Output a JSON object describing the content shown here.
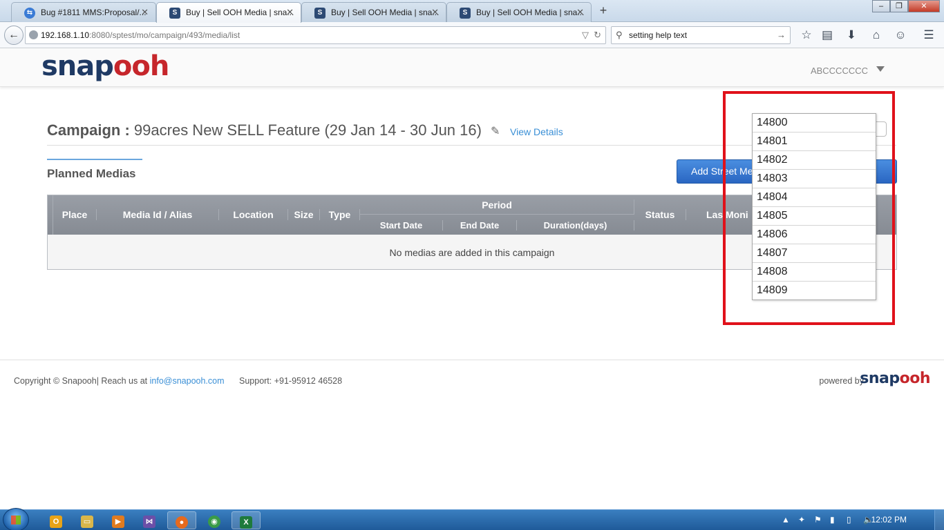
{
  "browser": {
    "tabs": [
      {
        "title": "Bug #1811 MMS:Proposal/...",
        "icon": "bug-tracker-favicon"
      },
      {
        "title": "Buy | Sell OOH Media | sna...",
        "icon": "snapooh-favicon"
      },
      {
        "title": "Buy | Sell OOH Media | sna...",
        "icon": "snapooh-favicon"
      },
      {
        "title": "Buy | Sell OOH Media | sna...",
        "icon": "snapooh-favicon"
      }
    ],
    "url_host": "192.168.1.10",
    "url_rest": ":8080/sptest/mo/campaign/493/media/list",
    "search_value": "setting help text"
  },
  "site": {
    "logo_part1": "snap",
    "logo_part2": "ooh",
    "user_name": "ABCCCCCCC",
    "brand_colors": {
      "navy": "#1f3a64",
      "red": "#c6262b",
      "link": "#3a8fd6"
    }
  },
  "campaign": {
    "label": "Campaign :",
    "name": "99acres New SELL Feature (29 Jan 14 - 30 Jun 16)",
    "view_details": "View Details"
  },
  "planned": {
    "title": "Planned Medias",
    "add_button": "Add Street Me",
    "add_button_tail": "a"
  },
  "table": {
    "headers": {
      "place": "Place",
      "media_id": "Media Id / Alias",
      "location": "Location",
      "size": "Size",
      "type": "Type",
      "period": "Period",
      "start_date": "Start Date",
      "end_date": "End Date",
      "duration": "Duration(days)",
      "status": "Status",
      "last_monitored": "Las  Moni"
    },
    "empty_message": "No medias are added in this campaign"
  },
  "dropdown": {
    "options": [
      "14800",
      "14801",
      "14802",
      "14803",
      "14804",
      "14805",
      "14806",
      "14807",
      "14808",
      "14809"
    ]
  },
  "footer": {
    "copyright": "Copyright © Snapooh| Reach us at",
    "email": "info@snapooh.com",
    "support": "Support: +91-95912 46528",
    "powered_by": "powered by"
  },
  "taskbar": {
    "clock": "12:02 PM"
  }
}
